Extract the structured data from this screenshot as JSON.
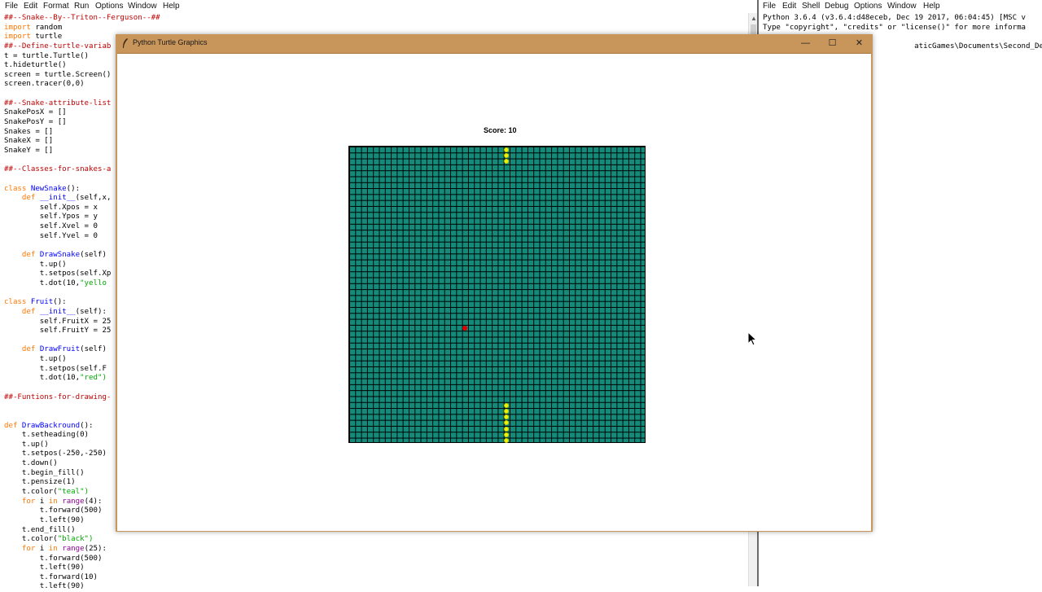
{
  "editor": {
    "menu": [
      "File",
      "Edit",
      "Format",
      "Run",
      "Options",
      "Window",
      "Help"
    ],
    "code_lines": [
      {
        "text": "##--Snake--By--Triton--Ferguson--##",
        "kind": "comment"
      },
      {
        "text": "import random",
        "kind": "import"
      },
      {
        "text": "import turtle",
        "kind": "import"
      },
      {
        "text": "##--Define-turtle-variab",
        "kind": "comment"
      },
      {
        "text": "t = turtle.Turtle()",
        "kind": "plain"
      },
      {
        "text": "t.hideturtle()",
        "kind": "plain"
      },
      {
        "text": "screen = turtle.Screen()",
        "kind": "plain"
      },
      {
        "text": "screen.tracer(0,0)",
        "kind": "plain"
      },
      {
        "text": "",
        "kind": "plain"
      },
      {
        "text": "##--Snake-attribute-list",
        "kind": "comment"
      },
      {
        "text": "SnakePosX = []",
        "kind": "plain"
      },
      {
        "text": "SnakePosY = []",
        "kind": "plain"
      },
      {
        "text": "Snakes = []",
        "kind": "plain"
      },
      {
        "text": "SnakeX = []",
        "kind": "plain"
      },
      {
        "text": "SnakeY = []",
        "kind": "plain"
      },
      {
        "text": "",
        "kind": "plain"
      },
      {
        "text": "##--Classes-for-snakes-a",
        "kind": "comment"
      },
      {
        "text": "",
        "kind": "plain"
      },
      {
        "text": "class NewSnake():",
        "kind": "class"
      },
      {
        "text": "    def __init__(self,x,",
        "kind": "def"
      },
      {
        "text": "        self.Xpos = x",
        "kind": "plain"
      },
      {
        "text": "        self.Ypos = y",
        "kind": "plain"
      },
      {
        "text": "        self.Xvel = 0",
        "kind": "plain"
      },
      {
        "text": "        self.Yvel = 0",
        "kind": "plain"
      },
      {
        "text": "",
        "kind": "plain"
      },
      {
        "text": "    def DrawSnake(self)",
        "kind": "def"
      },
      {
        "text": "        t.up()",
        "kind": "plain"
      },
      {
        "text": "        t.setpos(self.Xp",
        "kind": "plain"
      },
      {
        "text": "        t.dot(10,\"yello",
        "kind": "dot"
      },
      {
        "text": "",
        "kind": "plain"
      },
      {
        "text": "class Fruit():",
        "kind": "class"
      },
      {
        "text": "    def __init__(self):",
        "kind": "def"
      },
      {
        "text": "        self.FruitX = 25",
        "kind": "plain"
      },
      {
        "text": "        self.FruitY = 25",
        "kind": "plain"
      },
      {
        "text": "",
        "kind": "plain"
      },
      {
        "text": "    def DrawFruit(self)",
        "kind": "def"
      },
      {
        "text": "        t.up()",
        "kind": "plain"
      },
      {
        "text": "        t.setpos(self.F",
        "kind": "plain"
      },
      {
        "text": "        t.dot(10,\"red\")",
        "kind": "dot"
      },
      {
        "text": "",
        "kind": "plain"
      },
      {
        "text": "##-Funtions-for-drawing-",
        "kind": "comment"
      },
      {
        "text": "",
        "kind": "plain"
      },
      {
        "text": "",
        "kind": "plain"
      },
      {
        "text": "def DrawBackround():",
        "kind": "topdef"
      },
      {
        "text": "    t.setheading(0)",
        "kind": "plain"
      },
      {
        "text": "    t.up()",
        "kind": "plain"
      },
      {
        "text": "    t.setpos(-250,-250)",
        "kind": "plain"
      },
      {
        "text": "    t.down()",
        "kind": "plain"
      },
      {
        "text": "    t.begin_fill()",
        "kind": "plain"
      },
      {
        "text": "    t.pensize(1)",
        "kind": "plain"
      },
      {
        "text": "    t.color(\"teal\")",
        "kind": "color"
      },
      {
        "text": "    for i in range(4):",
        "kind": "for"
      },
      {
        "text": "        t.forward(500)",
        "kind": "plain"
      },
      {
        "text": "        t.left(90)",
        "kind": "plain"
      },
      {
        "text": "    t.end_fill()",
        "kind": "plain"
      },
      {
        "text": "    t.color(\"black\")",
        "kind": "color"
      },
      {
        "text": "    for i in range(25):",
        "kind": "for"
      },
      {
        "text": "        t.forward(500)",
        "kind": "plain"
      },
      {
        "text": "        t.left(90)",
        "kind": "plain"
      },
      {
        "text": "        t.forward(10)",
        "kind": "plain"
      },
      {
        "text": "        t.left(90)",
        "kind": "plain"
      }
    ]
  },
  "shell": {
    "menu": [
      "File",
      "Edit",
      "Shell",
      "Debug",
      "Options",
      "Window",
      "Help"
    ],
    "lines": [
      "Python 3.6.4 (v3.6.4:d48eceb, Dec 19 2017, 06:04:45) [MSC v",
      "Type \"copyright\", \"credits\" or \"license()\" for more informa",
      "",
      "                                  aticGames\\Documents\\Second_Desktop\\C"
    ]
  },
  "turtle_window": {
    "title": "Python Turtle Graphics",
    "minimize": "—",
    "maximize": "☐",
    "close": "✕",
    "score_text": "Score: 10",
    "grid_cells": 50,
    "board_color": "#138a7a",
    "snake_color": "#f2f200",
    "fruit_color": "#e00000",
    "snake_top_cells": [
      [
        26,
        0
      ],
      [
        26,
        1
      ],
      [
        26,
        2
      ]
    ],
    "snake_bottom_cells": [
      [
        26,
        43
      ],
      [
        26,
        44
      ],
      [
        26,
        45
      ],
      [
        26,
        46
      ],
      [
        26,
        47
      ],
      [
        26,
        48
      ],
      [
        26,
        49
      ]
    ],
    "fruit_cell": [
      19,
      30
    ]
  }
}
